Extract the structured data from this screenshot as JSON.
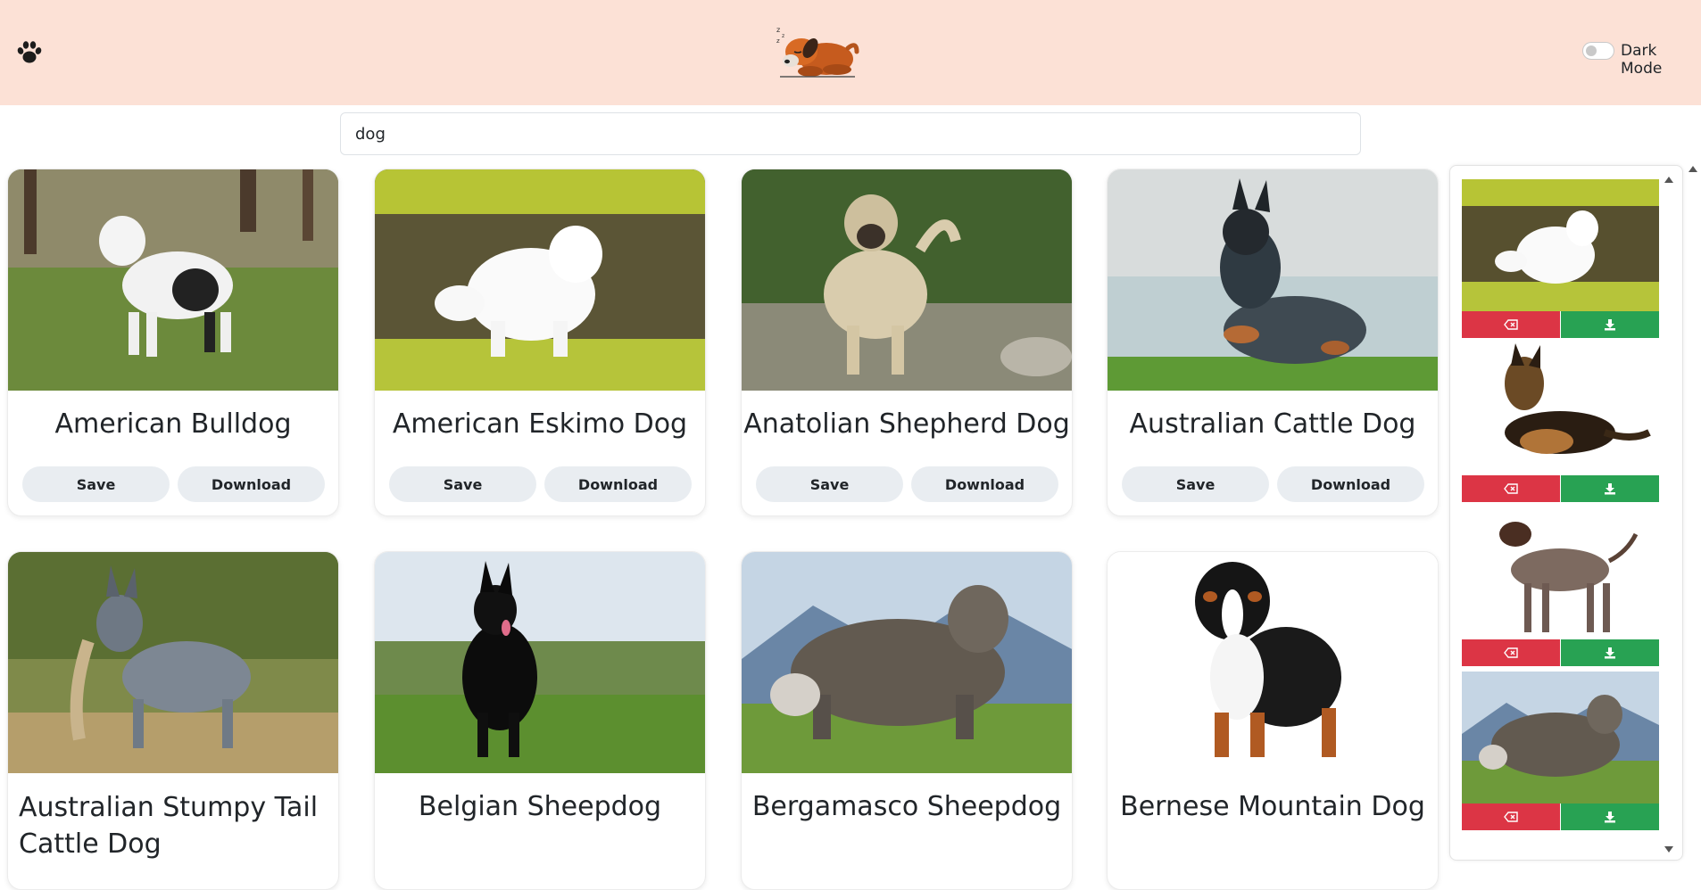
{
  "header": {
    "dark_mode_label": "Dark Mode",
    "dark_mode_on": false,
    "paw_icon": "paw-icon",
    "logo_icon": "sleeping-dog-logo"
  },
  "search": {
    "value": "dog",
    "placeholder": ""
  },
  "cards": [
    {
      "title": "American Bulldog",
      "save_label": "Save",
      "download_label": "Download"
    },
    {
      "title": "American Eskimo Dog",
      "save_label": "Save",
      "download_label": "Download"
    },
    {
      "title": "Anatolian Shepherd Dog",
      "save_label": "Save",
      "download_label": "Download"
    },
    {
      "title": "Australian Cattle Dog",
      "save_label": "Save",
      "download_label": "Download"
    },
    {
      "title": "Australian Stumpy Tail Cattle Dog"
    },
    {
      "title": "Belgian Sheepdog"
    },
    {
      "title": "Bergamasco Sheepdog"
    },
    {
      "title": "Bernese Mountain Dog"
    }
  ],
  "saved": [
    {
      "image": "american-eskimo-dog",
      "remove_icon": "backspace-x-icon",
      "download_icon": "download-icon"
    },
    {
      "image": "german-shepherd",
      "remove_icon": "backspace-x-icon",
      "download_icon": "download-icon"
    },
    {
      "image": "german-shorthaired-pointer",
      "remove_icon": "backspace-x-icon",
      "download_icon": "download-icon"
    },
    {
      "image": "bergamasco-sheepdog",
      "remove_icon": "backspace-x-icon",
      "download_icon": "download-icon"
    }
  ],
  "colors": {
    "header_bg": "#fce1d6",
    "button_bg": "#e9edf1",
    "delete_red": "#dc3545",
    "download_green": "#28a253"
  }
}
